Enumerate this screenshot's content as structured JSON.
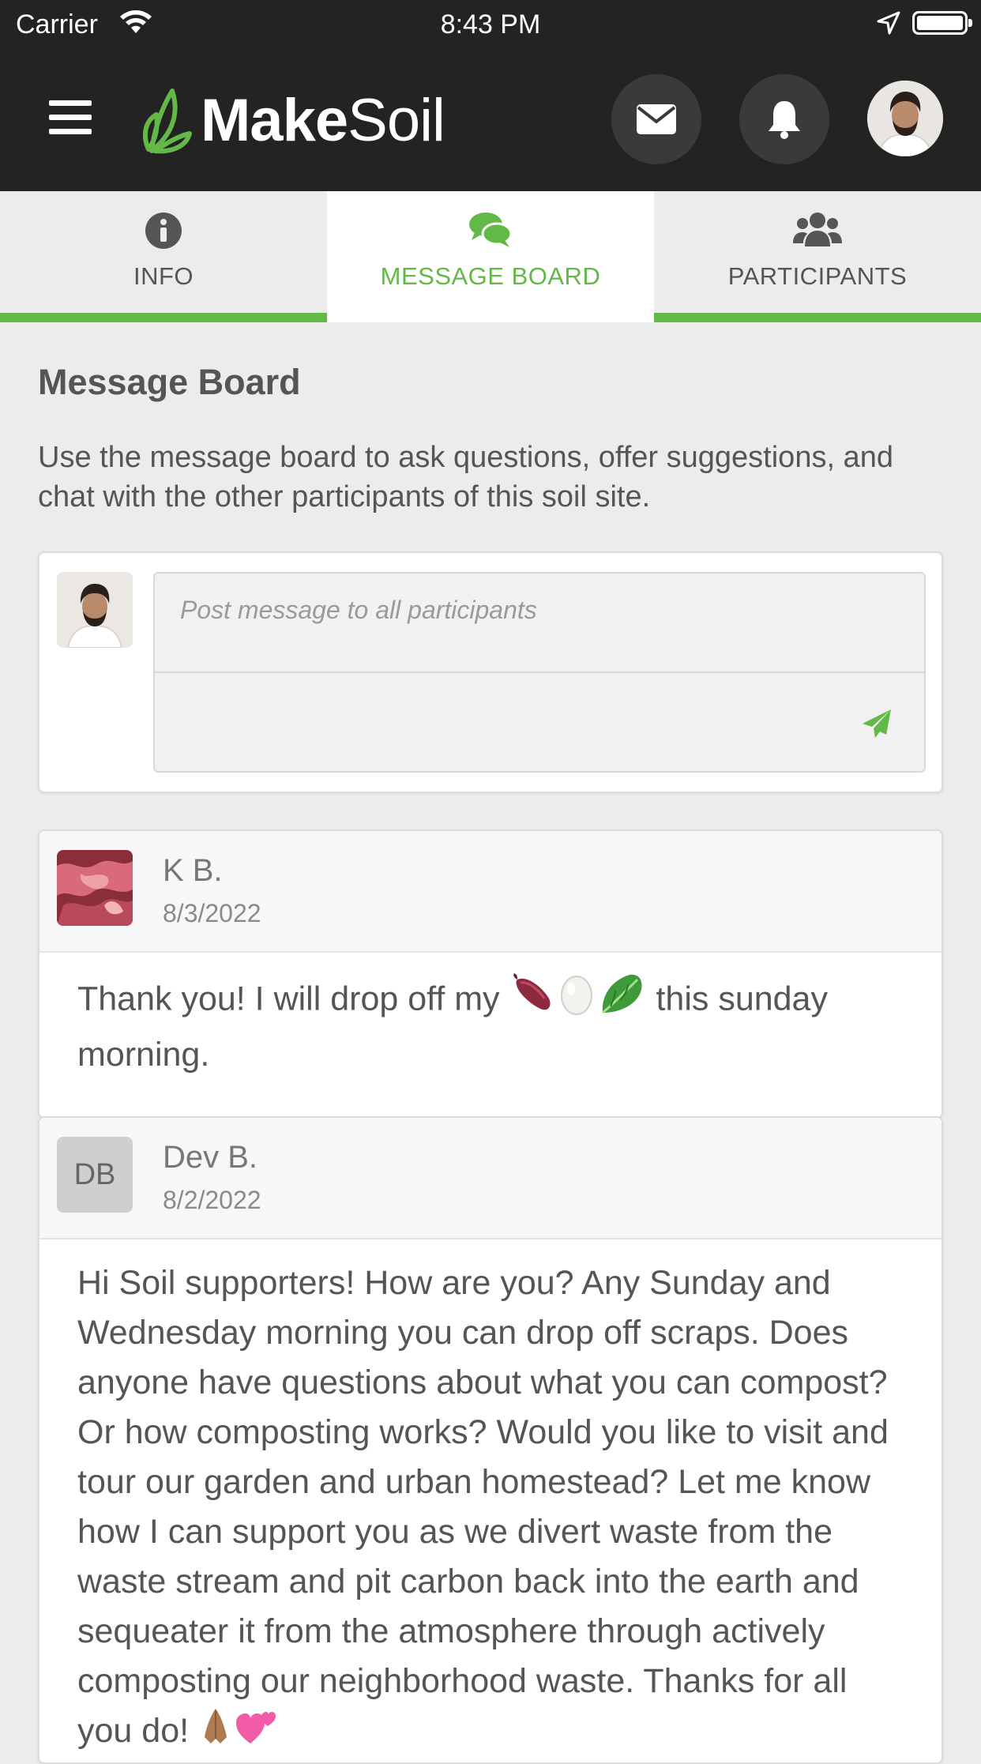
{
  "status_bar": {
    "carrier": "Carrier",
    "time": "8:43 PM"
  },
  "header": {
    "logo_bold": "Make",
    "logo_light": "Soil"
  },
  "tabs": [
    {
      "label": "INFO",
      "icon": "info-circle-icon",
      "active": false
    },
    {
      "label": "MESSAGE BOARD",
      "icon": "comments-icon",
      "active": true
    },
    {
      "label": "PARTICIPANTS",
      "icon": "users-icon",
      "active": false
    }
  ],
  "main": {
    "title": "Message Board",
    "description": "Use the message board to ask questions, offer suggestions, and chat with the other participants of this soil site."
  },
  "composer": {
    "placeholder": "Post message to all participants"
  },
  "posts": [
    {
      "author": "K B.",
      "date": "8/3/2022",
      "body_start": "Thank you! I will drop off my",
      "body_end": "this sunday morning."
    },
    {
      "author": "Dev B.",
      "initials": "DB",
      "date": "8/2/2022",
      "body": "Hi Soil supporters! How are you? Any Sunday and Wednesday morning you can drop off scraps. Does anyone have questions about what you can compost? Or how composting works? Would you like to visit and tour our garden and urban homestead? Let me know how I can support you as we divert waste from the waste stream and pit carbon back into the earth and sequeater it from the atmosphere through actively composting our neighborhood waste. Thanks for all you do!"
    }
  ],
  "colors": {
    "accent": "#62b946",
    "header_bg": "#232323",
    "page_bg": "#ececec"
  }
}
